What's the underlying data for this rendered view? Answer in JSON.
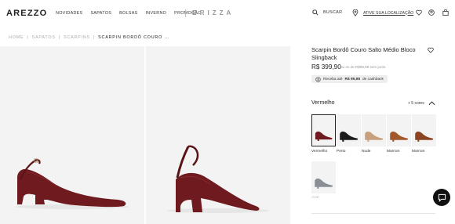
{
  "header": {
    "logo": "AREZZO",
    "nav": [
      "NOVIDADES",
      "SAPATOS",
      "BOLSAS",
      "INVERNO",
      "PROMOÇÃO"
    ],
    "brand": "BRIZZA",
    "search_label": "BUSCAR",
    "location_label": "ATIVE SUA LOCALIZAÇÃO"
  },
  "breadcrumb": {
    "items": [
      "HOME",
      "SAPATOS",
      "SCARPINS"
    ],
    "current": "SCARPIN BORDÔ COURO ..."
  },
  "product": {
    "title": "Scarpin Bordô Couro Salto Médio Bloco Slingback",
    "price": "R$ 399,90",
    "installments": "ou 4x de R$99,98 sem juros",
    "cashback_prefix": "Receba até",
    "cashback_value": "R$ 95,98",
    "cashback_suffix": "de cashback"
  },
  "colors": {
    "label": "Vermelho",
    "more": "+ 5 cores",
    "options": [
      "Vermelho",
      "Preto",
      "Nude",
      "Marrom",
      "Marrom",
      "Azul"
    ],
    "selected": "Vermelho",
    "shoe_colors": [
      "#6e1a1e",
      "#1a1a1a",
      "#c9a07e",
      "#a2582c",
      "#8a4520",
      "#8a8f96"
    ]
  },
  "icons": [
    "search-icon",
    "location-pin-icon",
    "heart-icon",
    "user-icon",
    "bag-icon",
    "cashback-icon",
    "chevron-up-icon",
    "chat-icon"
  ]
}
